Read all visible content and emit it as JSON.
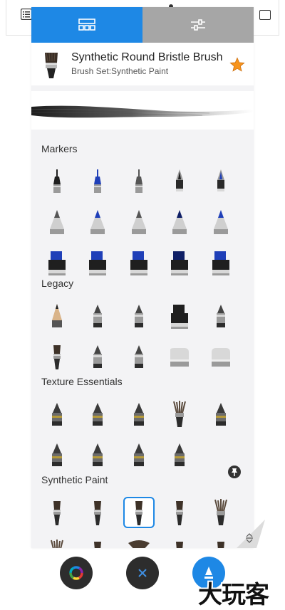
{
  "header": {
    "brush_name": "Synthetic Round Bristle Brush",
    "brush_set": "Brush Set:Synthetic Paint",
    "favorite": true
  },
  "tabs": [
    {
      "name": "library",
      "icon": "brush-library-icon",
      "active": true
    },
    {
      "name": "settings",
      "icon": "sliders-icon",
      "active": false
    }
  ],
  "sections": [
    {
      "title": "Markers",
      "tools": [
        "fineliner-black",
        "fineliner-blue",
        "fineliner-gray",
        "technical-pen-black",
        "technical-pen-blue",
        "bullet-marker-gray",
        "bullet-marker-blue",
        "bullet-marker-gray-2",
        "bullet-marker-navy",
        "bullet-marker-blue-2",
        "chisel-marker-blue",
        "chisel-marker-blue-2",
        "chisel-marker-blue-3",
        "wide-marker-navy",
        "wide-marker-blue"
      ]
    },
    {
      "title": "Legacy",
      "tools": [
        "pencil",
        "airbrush",
        "marker",
        "chisel-marker",
        "ballpoint",
        "paintbrush",
        "felt-tip",
        "ink-pen",
        "hard-eraser",
        "soft-eraser"
      ]
    },
    {
      "title": "Texture Essentials",
      "tools": [
        "texture-pencil",
        "texture-cone",
        "texture-block",
        "texture-bristle",
        "texture-smudge",
        "texture-dome",
        "texture-round",
        "texture-stamp",
        "texture-flat"
      ]
    },
    {
      "title": "Synthetic Paint",
      "tools": [
        "synthetic-thin",
        "synthetic-fan-small",
        "synthetic-round-bristle",
        "synthetic-flat",
        "synthetic-spiky",
        "synthetic-spiky-2",
        "synthetic-detail",
        "synthetic-fan",
        "synthetic-flat-2",
        "synthetic-small"
      ],
      "selected": "synthetic-round-bristle"
    }
  ],
  "bottom_buttons": [
    "color-wheel-icon",
    "close-icon",
    "brush-icon"
  ],
  "watermark": "大玩客",
  "colors": {
    "accent": "#1e88e5",
    "tab_inactive": "#a6a6a6",
    "panel": "#f3f3f5",
    "star": "#f7941d",
    "dark_button": "#2d2d2d"
  }
}
